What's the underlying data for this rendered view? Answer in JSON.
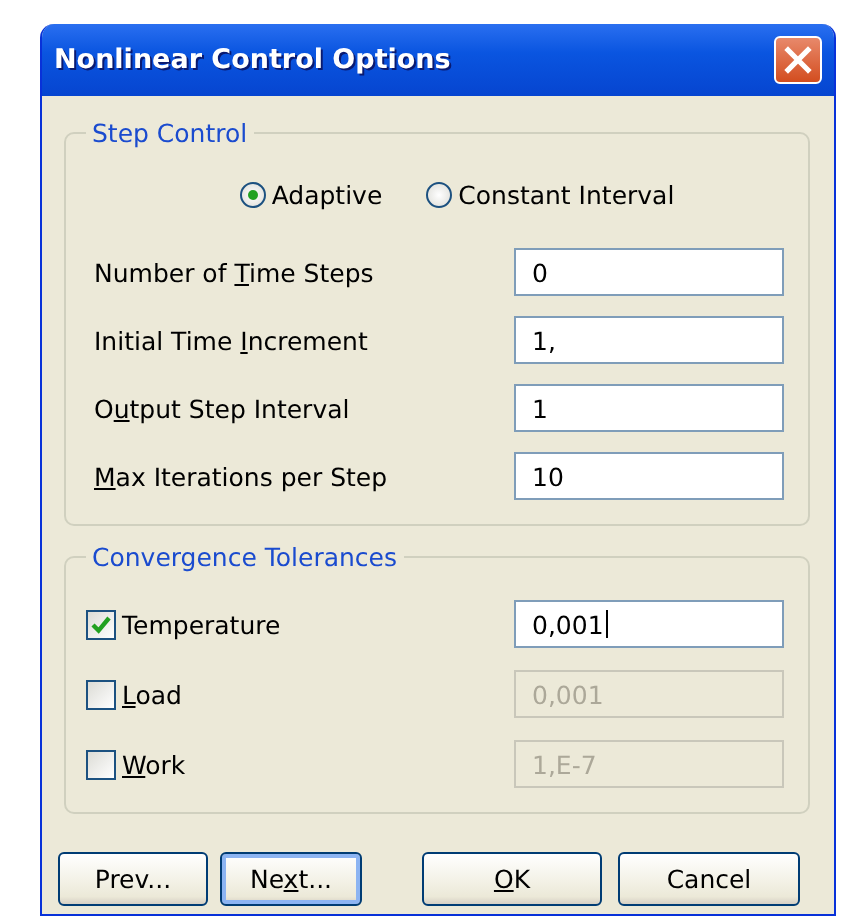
{
  "window": {
    "title": "Nonlinear Control Options"
  },
  "step_control": {
    "title": "Step Control",
    "modes": [
      {
        "label": "Adaptive",
        "selected": true
      },
      {
        "label": "Constant Interval",
        "selected": false
      }
    ],
    "fields": [
      {
        "label": [
          {
            "text": "Number of ",
            "underlined": false
          },
          {
            "text": "T",
            "underlined": true
          },
          {
            "text": "ime Steps",
            "underlined": false
          }
        ],
        "value": "0"
      },
      {
        "label": [
          {
            "text": "Initial Time ",
            "underlined": false
          },
          {
            "text": "I",
            "underlined": true
          },
          {
            "text": "ncrement",
            "underlined": false
          }
        ],
        "value": "1,"
      },
      {
        "label": [
          {
            "text": "O",
            "underlined": false
          },
          {
            "text": "u",
            "underlined": true
          },
          {
            "text": "tput Step Interval",
            "underlined": false
          }
        ],
        "value": "1"
      },
      {
        "label": [
          {
            "text": "M",
            "underlined": true
          },
          {
            "text": "ax Iterations per Step",
            "underlined": false
          }
        ],
        "value": "10"
      }
    ]
  },
  "convergence": {
    "title": "Convergence Tolerances",
    "items": [
      {
        "label": [
          {
            "text": "Temperature",
            "underlined": false
          }
        ],
        "checked": true,
        "value": "0,001",
        "focused": true
      },
      {
        "label": [
          {
            "text": "L",
            "underlined": true
          },
          {
            "text": "oad",
            "underlined": false
          }
        ],
        "checked": false,
        "value": "0,001",
        "focused": false
      },
      {
        "label": [
          {
            "text": "W",
            "underlined": true
          },
          {
            "text": "ork",
            "underlined": false
          }
        ],
        "checked": false,
        "value": "1,E-7",
        "focused": false
      }
    ]
  },
  "buttons": [
    {
      "label": [
        {
          "text": "Prev...",
          "underlined": false
        }
      ],
      "default": false
    },
    {
      "label": [
        {
          "text": "Ne",
          "underlined": false
        },
        {
          "text": "x",
          "underlined": true
        },
        {
          "text": "t...",
          "underlined": false
        }
      ],
      "default": true
    },
    {
      "label": [
        {
          "text": "O",
          "underlined": true
        },
        {
          "text": "K",
          "underlined": false
        }
      ],
      "default": false
    },
    {
      "label": [
        {
          "text": "Cancel",
          "underlined": false
        }
      ],
      "default": false
    }
  ]
}
